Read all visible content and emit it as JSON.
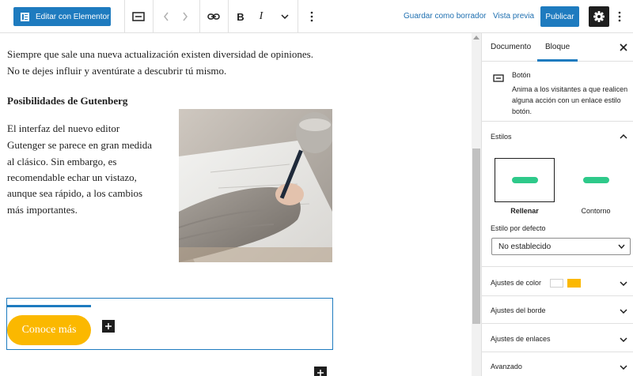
{
  "toolbar": {
    "elementor_label": "Editar con Elementor",
    "bold_label": "B",
    "italic_label": "I",
    "save_draft_label": "Guardar como borrador",
    "preview_label": "Vista previa",
    "publish_label": "Publicar"
  },
  "editor": {
    "intro_lines": [
      "Siempre que sale una nueva actualización existen diversidad de opiniones.",
      "No te dejes influir y aventúrate a descubrir tú mismo."
    ],
    "heading": "Posibilidades de Gutenberg",
    "body_lines": [
      "El interfaz del nuevo editor",
      "Gutenger se parece en gran medida",
      "al clásico. Sin embargo, es",
      "recomendable echar un vistazo,",
      "aunque sea rápido, a los cambios",
      "más importantes."
    ],
    "image_icon": "photo-writing-hand",
    "button_label": "Conoce más",
    "button_color": "#fbb800"
  },
  "sidebar": {
    "tabs": [
      "Documento",
      "Bloque"
    ],
    "active_tab": "Bloque",
    "block_name": "Botón",
    "block_description": "Anima a los visitantes a que realicen alguna acción con un enlace estilo botón.",
    "styles_title": "Estilos",
    "styles": [
      "Rellenar",
      "Contorno"
    ],
    "active_style": "Rellenar",
    "default_style_label": "Estilo por defecto",
    "default_style_value": "No establecido",
    "panels": [
      "Ajustes de color",
      "Ajustes del borde",
      "Ajustes de enlaces",
      "Avanzado"
    ],
    "color_swatches": [
      "#ffffff",
      "#fbb800"
    ]
  },
  "colors": {
    "accent": "#1e7bbf",
    "mini_button": "#2ec98a"
  }
}
